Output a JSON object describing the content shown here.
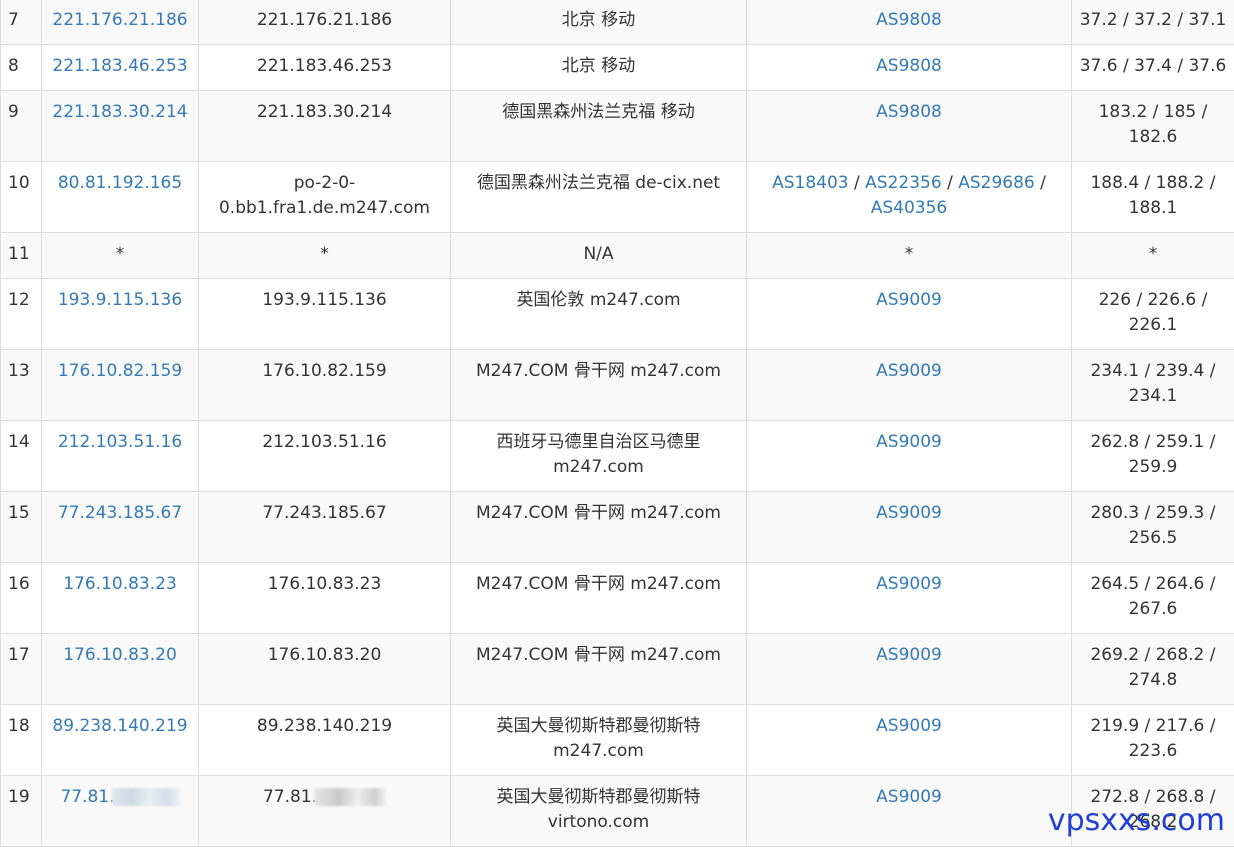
{
  "rows": [
    {
      "hop": "7",
      "ip": "221.176.21.186",
      "host": "221.176.21.186",
      "location": "北京 移动",
      "asn": [
        "AS9808"
      ],
      "latency": "37.2 / 37.2 / 37.1"
    },
    {
      "hop": "8",
      "ip": "221.183.46.253",
      "host": "221.183.46.253",
      "location": "北京 移动",
      "asn": [
        "AS9808"
      ],
      "latency": "37.6 / 37.4 / 37.6"
    },
    {
      "hop": "9",
      "ip": "221.183.30.214",
      "host": "221.183.30.214",
      "location": "德国黑森州法兰克福 移动",
      "asn": [
        "AS9808"
      ],
      "latency": "183.2 / 185 / 182.6"
    },
    {
      "hop": "10",
      "ip": "80.81.192.165",
      "host": "po-2-0-0.bb1.fra1.de.m247.com",
      "location": "德国黑森州法兰克福 de-cix.net",
      "asn": [
        "AS18403",
        "AS22356",
        "AS29686",
        "AS40356"
      ],
      "latency": "188.4 / 188.2 / 188.1"
    },
    {
      "hop": "11",
      "ip": "*",
      "host": "*",
      "location": "N/A",
      "asn": [
        "*"
      ],
      "latency": "*"
    },
    {
      "hop": "12",
      "ip": "193.9.115.136",
      "host": "193.9.115.136",
      "location": "英国伦敦 m247.com",
      "asn": [
        "AS9009"
      ],
      "latency": "226 / 226.6 / 226.1"
    },
    {
      "hop": "13",
      "ip": "176.10.82.159",
      "host": "176.10.82.159",
      "location": "M247.COM 骨干网 m247.com",
      "asn": [
        "AS9009"
      ],
      "latency": "234.1 / 239.4 / 234.1"
    },
    {
      "hop": "14",
      "ip": "212.103.51.16",
      "host": "212.103.51.16",
      "location": "西班牙马德里自治区马德里 m247.com",
      "asn": [
        "AS9009"
      ],
      "latency": "262.8 / 259.1 / 259.9"
    },
    {
      "hop": "15",
      "ip": "77.243.185.67",
      "host": "77.243.185.67",
      "location": "M247.COM 骨干网 m247.com",
      "asn": [
        "AS9009"
      ],
      "latency": "280.3 / 259.3 / 256.5"
    },
    {
      "hop": "16",
      "ip": "176.10.83.23",
      "host": "176.10.83.23",
      "location": "M247.COM 骨干网 m247.com",
      "asn": [
        "AS9009"
      ],
      "latency": "264.5 / 264.6 / 267.6"
    },
    {
      "hop": "17",
      "ip": "176.10.83.20",
      "host": "176.10.83.20",
      "location": "M247.COM 骨干网 m247.com",
      "asn": [
        "AS9009"
      ],
      "latency": "269.2 / 268.2 / 274.8"
    },
    {
      "hop": "18",
      "ip": "89.238.140.219",
      "host": "89.238.140.219",
      "location": "英国大曼彻斯特郡曼彻斯特 m247.com",
      "asn": [
        "AS9009"
      ],
      "latency": "219.9 / 217.6 / 223.6"
    },
    {
      "hop": "19",
      "ip": "77.81.",
      "host": "77.81.",
      "location": "英国大曼彻斯特郡曼彻斯特 virtono.com",
      "asn": [
        "AS9009"
      ],
      "latency": "272.8 / 268.8 / 268.2"
    }
  ],
  "watermark": "vpsxxs.com",
  "colors": {
    "link": "#337ab7",
    "text": "#333333",
    "stripe": "#f9f9f9",
    "border": "#dddddd",
    "watermark": "#1f3fd6"
  }
}
